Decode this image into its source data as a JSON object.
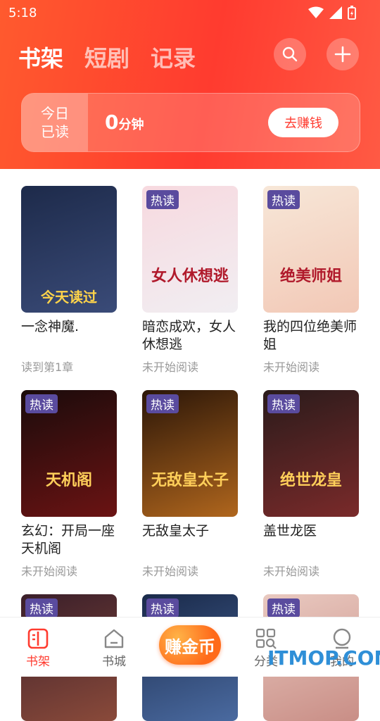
{
  "status_bar": {
    "time": "5:18"
  },
  "header": {
    "tabs": [
      "书架",
      "短剧",
      "记录"
    ],
    "today": {
      "label_line1": "今日",
      "label_line2": "已读",
      "minutes": "0",
      "unit": "分钟",
      "earn_button": "去赚钱"
    }
  },
  "books": [
    {
      "title": "一念神魔.",
      "status": "读到第1章",
      "badge": "",
      "cover_text": "今天读过",
      "cover_colors": [
        "#1d2a4a",
        "#3a4b78"
      ]
    },
    {
      "title": "暗恋成欢，女人休想逃",
      "status": "未开始阅读",
      "badge": "热读",
      "cover_text": "女人休想逃",
      "cover_colors": [
        "#f7d9df",
        "#f1eef2"
      ]
    },
    {
      "title": "我的四位绝美师姐",
      "status": "未开始阅读",
      "badge": "热读",
      "cover_text": "绝美师姐",
      "cover_colors": [
        "#f7e7d8",
        "#f2c8b6"
      ]
    },
    {
      "title": "玄幻：开局一座天机阁",
      "status": "未开始阅读",
      "badge": "热读",
      "cover_text": "天机阁",
      "cover_colors": [
        "#1a0b0b",
        "#6b1313"
      ]
    },
    {
      "title": "无敌皇太子",
      "status": "未开始阅读",
      "badge": "热读",
      "cover_text": "无敌皇太子",
      "cover_colors": [
        "#2b1608",
        "#b0661d"
      ]
    },
    {
      "title": "盖世龙医",
      "status": "未开始阅读",
      "badge": "热读",
      "cover_text": "绝世龙皇",
      "cover_colors": [
        "#2a1b1b",
        "#7a2a2a"
      ]
    },
    {
      "title": "",
      "status": "",
      "badge": "热读",
      "cover_text": "",
      "cover_colors": [
        "#3a1f2a",
        "#8a4a3a"
      ]
    },
    {
      "title": "",
      "status": "",
      "badge": "热读",
      "cover_text": "",
      "cover_colors": [
        "#1a2a4a",
        "#4a6aa0"
      ]
    },
    {
      "title": "",
      "status": "",
      "badge": "热读",
      "cover_text": "",
      "cover_colors": [
        "#e9c9c0",
        "#c98e86"
      ]
    }
  ],
  "bottom_nav": {
    "items": [
      {
        "label": "书架",
        "icon": "book-icon"
      },
      {
        "label": "书城",
        "icon": "home-icon"
      },
      {
        "label": "分类",
        "icon": "grid-search-icon"
      },
      {
        "label": "我的",
        "icon": "profile-icon"
      }
    ],
    "center_button": "赚金币",
    "watermark": "ITMOP.COM"
  },
  "colors": {
    "accent": "#ff3b2f",
    "badge": "#5a4b9e"
  }
}
